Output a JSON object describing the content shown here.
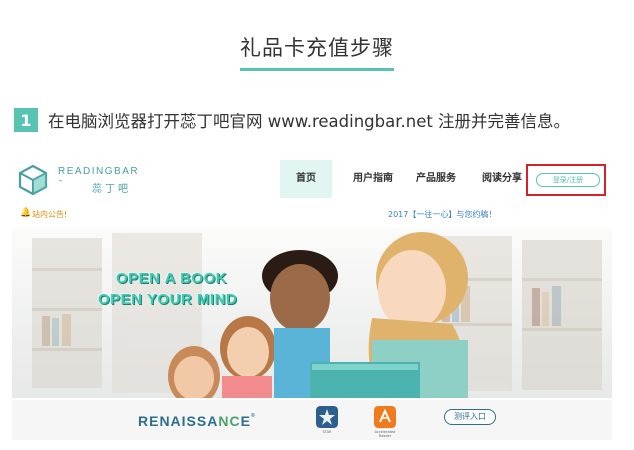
{
  "page": {
    "title": "礼品卡充值步骤"
  },
  "step": {
    "number": "1",
    "text": "在电脑浏览器打开蕊丁吧官网 www.readingbar.net 注册并完善信息。"
  },
  "site": {
    "logo_text_en": "READINGBAR",
    "logo_text_cn": "蕊丁吧",
    "nav": [
      "首页",
      "用户指南",
      "产品服务",
      "阅读分享"
    ],
    "login_label": "登录/注册",
    "notice_label": "站内公告!",
    "notice_text": "2017【一往一心】与您约稿！",
    "slogan_line1": "Open A Book",
    "slogan_line2": "Open Your Mind",
    "partner_logo": "RENAISSANCE",
    "partner_logo_main": "RENAISSA",
    "partner_logo_accent": "NC",
    "partner_logo_tail": "E",
    "star_label": "STAR",
    "accelerated_label": "Accelerated Reader",
    "eval_button": "测评入口"
  },
  "colors": {
    "accent": "#56c3b3",
    "highlight_border": "#d4222a",
    "brand_blue": "#2c6e8e"
  },
  "icons": {
    "logo": "readingbar-cube-logo",
    "bell": "bell-icon",
    "star_badge": "star-badge-icon",
    "ar_badge": "book-badge-icon"
  }
}
